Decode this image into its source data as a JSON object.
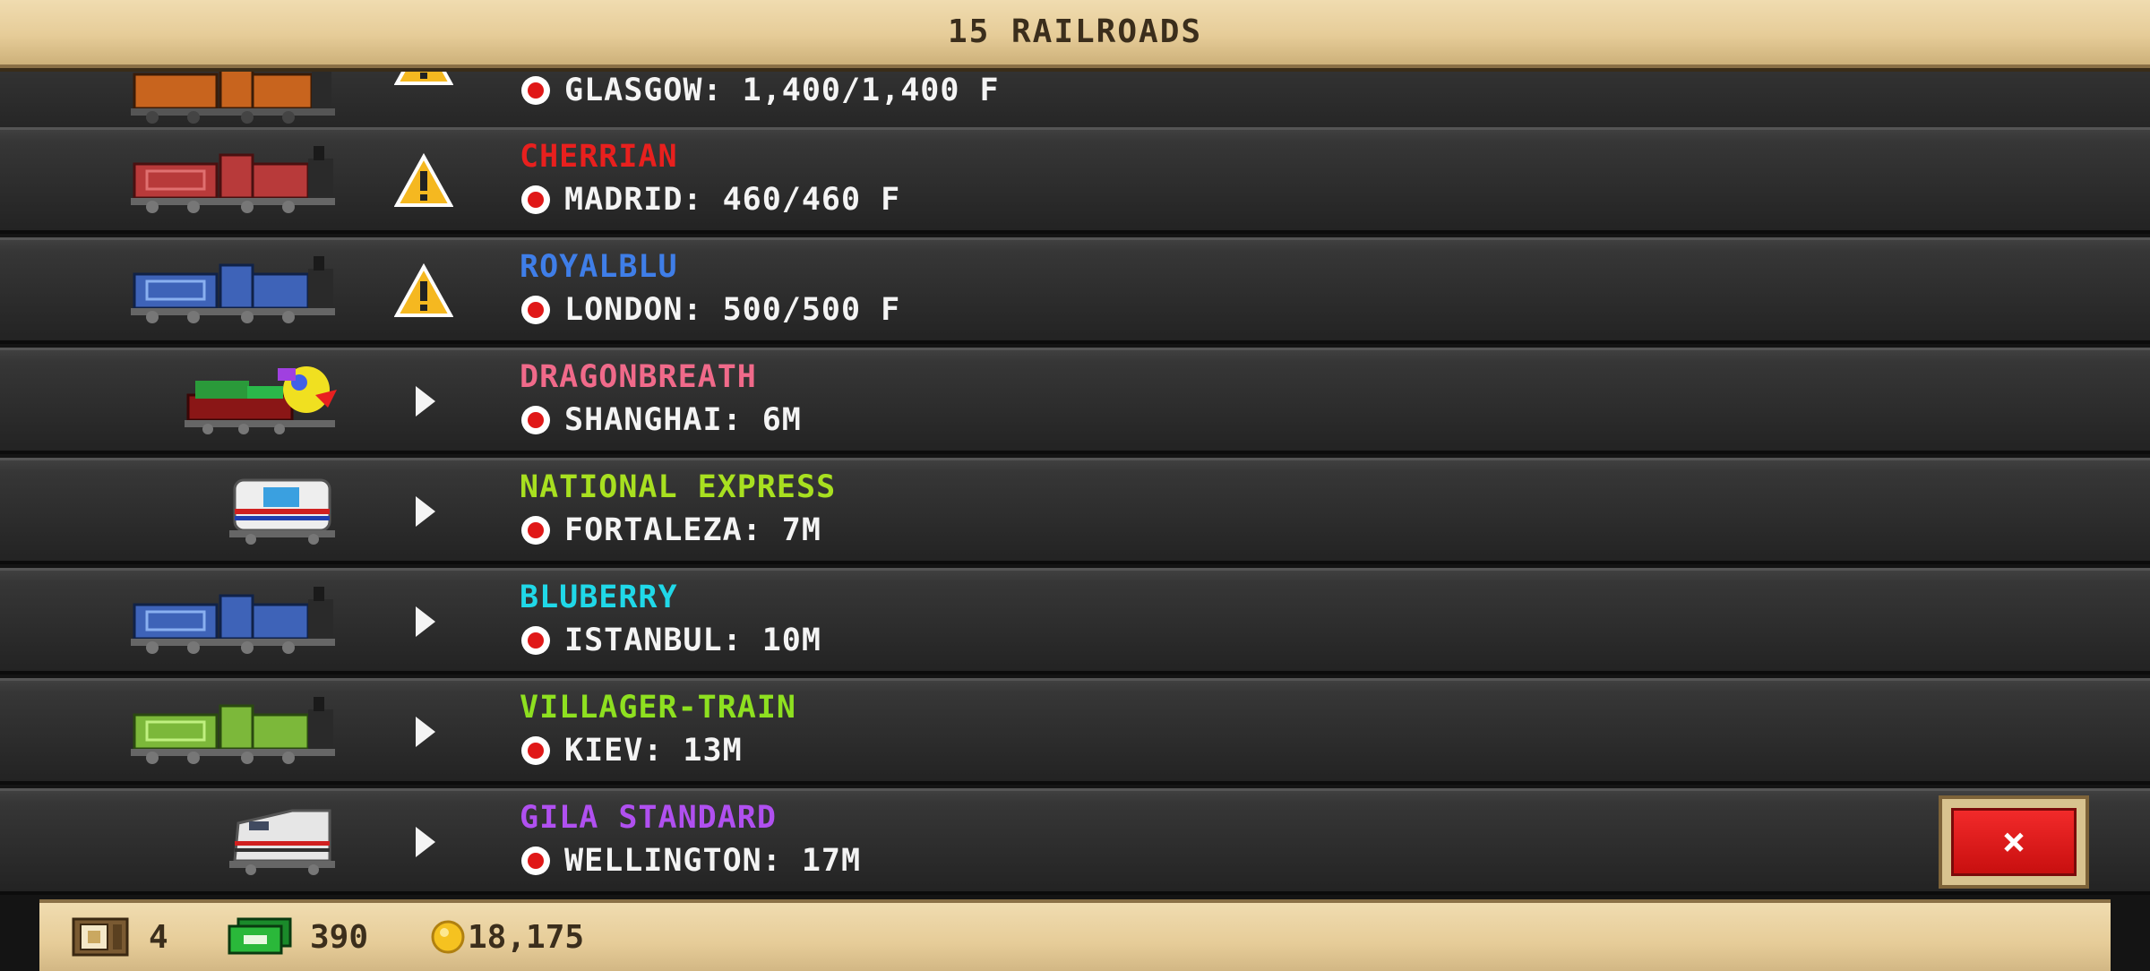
{
  "header": {
    "title": "15 RAILROADS"
  },
  "railroads": [
    {
      "name": "",
      "name_color": "#ff8a2a",
      "station": "GLASGOW: 1,400/1,400 F",
      "status_icon": "warning-icon",
      "train_color": "#c8641e"
    },
    {
      "name": "CHERRIAN",
      "name_color": "#e8201e",
      "station": "MADRID: 460/460 F",
      "status_icon": "warning-icon",
      "train_color": "#b83a3a"
    },
    {
      "name": "ROYALBLU",
      "name_color": "#3f7ee8",
      "station": "LONDON: 500/500 F",
      "status_icon": "warning-icon",
      "train_color": "#3e63b8"
    },
    {
      "name": "DRAGONBREATH",
      "name_color": "#f06a8a",
      "station": "SHANGHAI: 6M",
      "status_icon": "play-arrow-icon",
      "train_color": "#8a1616"
    },
    {
      "name": "NATIONAL EXPRESS",
      "name_color": "#a8e020",
      "station": "FORTALEZA: 7M",
      "status_icon": "play-arrow-icon",
      "train_color": "#e8e8e8"
    },
    {
      "name": "BLUBERRY",
      "name_color": "#20d8e8",
      "station": "ISTANBUL: 10M",
      "status_icon": "play-arrow-icon",
      "train_color": "#3e63b8"
    },
    {
      "name": "VILLAGER-TRAIN",
      "name_color": "#8ee020",
      "station": "KIEV: 13M",
      "status_icon": "play-arrow-icon",
      "train_color": "#7cb83a"
    },
    {
      "name": "GILA STANDARD",
      "name_color": "#b050f0",
      "station": "WELLINGTON: 17M",
      "status_icon": "play-arrow-icon",
      "train_color": "#e0e0e0"
    }
  ],
  "close_button": {
    "label": "×"
  },
  "footer": {
    "cars": "4",
    "cash": "390",
    "coins": "18,175"
  }
}
